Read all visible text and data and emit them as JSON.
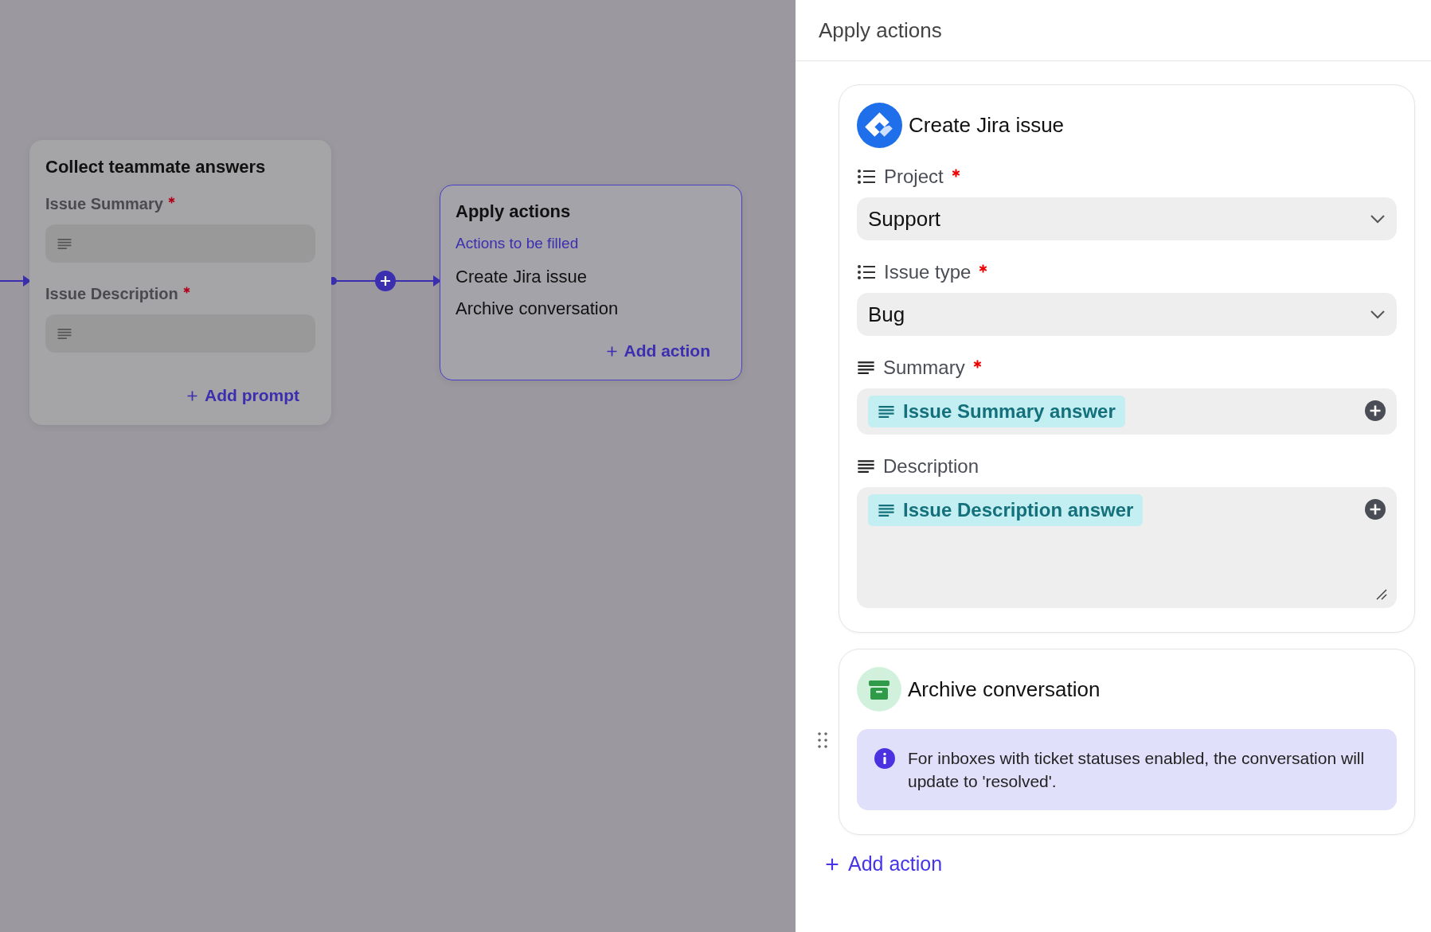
{
  "canvas": {
    "nodes": [
      {
        "kind": "prompts",
        "title": "Collect teammate answers",
        "selected": false,
        "prompts": [
          {
            "label": "Issue Summary",
            "required": true
          },
          {
            "label": "Issue Description",
            "required": true
          }
        ],
        "add_label": "Add prompt"
      },
      {
        "kind": "actions",
        "title": "Apply actions",
        "selected": true,
        "subtitle": "Actions to be filled",
        "items": [
          "Create Jira issue",
          "Archive conversation"
        ],
        "add_label": "Add action"
      }
    ]
  },
  "panel": {
    "title": "Apply actions",
    "actions": [
      {
        "kind": "jira",
        "title": "Create Jira issue",
        "fields": [
          {
            "kind": "select",
            "label": "Project",
            "required": true,
            "value": "Support"
          },
          {
            "kind": "select",
            "label": "Issue type",
            "required": true,
            "value": "Bug"
          },
          {
            "kind": "token",
            "label": "Summary",
            "required": true,
            "value": "Issue Summary answer"
          },
          {
            "kind": "textarea",
            "label": "Description",
            "required": false,
            "value": "Issue Description answer"
          }
        ]
      },
      {
        "kind": "archive",
        "title": "Archive conversation",
        "notice": "For inboxes with ticket statuses enabled, the conversation will update to 'resolved'."
      }
    ],
    "add_label": "Add action"
  }
}
